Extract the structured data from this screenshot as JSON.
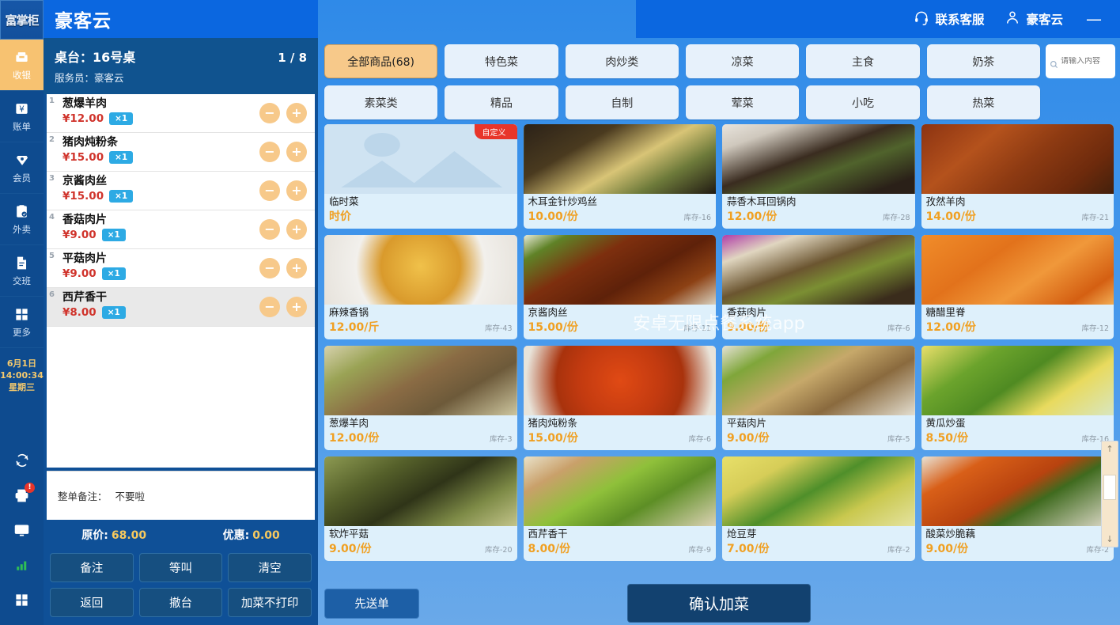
{
  "rail": {
    "logo": "富掌柜",
    "items": [
      {
        "label": "收银",
        "icon": "cash-register-icon",
        "active": true
      },
      {
        "label": "账单",
        "icon": "bill-icon",
        "active": false
      },
      {
        "label": "会员",
        "icon": "member-diamond-icon",
        "active": false
      },
      {
        "label": "外卖",
        "icon": "takeout-clipboard-icon",
        "active": false
      },
      {
        "label": "交班",
        "icon": "shift-handover-icon",
        "active": false
      },
      {
        "label": "更多",
        "icon": "more-grid-icon",
        "active": false
      }
    ],
    "datetime": {
      "date": "6月1日",
      "time": "14:00:34",
      "weekday": "星期三"
    },
    "bottom_icons": [
      {
        "name": "refresh-sync-icon",
        "badge": ""
      },
      {
        "name": "printer-icon",
        "badge": "!"
      },
      {
        "name": "monitor-icon",
        "badge": ""
      },
      {
        "name": "signal-bars-icon",
        "badge": ""
      },
      {
        "name": "apps-grid-icon",
        "badge": ""
      }
    ]
  },
  "header": {
    "app_title": "豪客云",
    "support_label": "联系客服",
    "user_label": "豪客云",
    "minimize_label": "—"
  },
  "order": {
    "table_label": "桌台：",
    "table_name": "16号桌",
    "page_indicator": "1 / 8",
    "staff_label": "服务员：",
    "staff_name": "豪客云",
    "items": [
      {
        "index": "1",
        "name": "葱爆羊肉",
        "price": "¥12.00",
        "qty": "×1"
      },
      {
        "index": "2",
        "name": "猪肉炖粉条",
        "price": "¥15.00",
        "qty": "×1"
      },
      {
        "index": "3",
        "name": "京酱肉丝",
        "price": "¥15.00",
        "qty": "×1"
      },
      {
        "index": "4",
        "name": "香菇肉片",
        "price": "¥9.00",
        "qty": "×1"
      },
      {
        "index": "5",
        "name": "平菇肉片",
        "price": "¥9.00",
        "qty": "×1"
      },
      {
        "index": "6",
        "name": "西芹香干",
        "price": "¥8.00",
        "qty": "×1"
      }
    ],
    "remark_label": "整单备注：",
    "remark_value": "不要啦",
    "original_price_label": "原价:",
    "original_price": "68.00",
    "discount_label": "优惠:",
    "discount": "0.00",
    "actions": [
      "备注",
      "等叫",
      "清空",
      "返回",
      "撤台",
      "加菜不打印"
    ],
    "minus_label": "−",
    "plus_label": "+"
  },
  "categories": [
    {
      "label": "全部商品(68)",
      "active": true
    },
    {
      "label": "特色菜",
      "active": false
    },
    {
      "label": "肉炒类",
      "active": false
    },
    {
      "label": "凉菜",
      "active": false
    },
    {
      "label": "主食",
      "active": false
    },
    {
      "label": "奶茶",
      "active": false
    },
    {
      "label": "素菜类",
      "active": false
    },
    {
      "label": "精品",
      "active": false
    },
    {
      "label": "自制",
      "active": false
    },
    {
      "label": "荤菜",
      "active": false
    },
    {
      "label": "小吃",
      "active": false
    },
    {
      "label": "热菜",
      "active": false
    }
  ],
  "search": {
    "placeholder": "请输入内容",
    "value": ""
  },
  "products": [
    {
      "name": "临时菜",
      "price": "时价",
      "stock": "",
      "ribbon": "自定义",
      "img": "placeholder"
    },
    {
      "name": "木耳金针炒鸡丝",
      "price": "10.00/份",
      "stock": "库存-16",
      "ribbon": "",
      "img": "noodle-stirfry"
    },
    {
      "name": "蒜香木耳回锅肉",
      "price": "12.00/份",
      "stock": "库存-28",
      "ribbon": "",
      "img": "fungus-pork"
    },
    {
      "name": "孜然羊肉",
      "price": "14.00/份",
      "stock": "库存-21",
      "ribbon": "",
      "img": "cumin-lamb"
    },
    {
      "name": "麻辣香锅",
      "price": "12.00/斤",
      "stock": "库存-43",
      "ribbon": "",
      "img": "spicy-pot"
    },
    {
      "name": "京酱肉丝",
      "price": "15.00/份",
      "stock": "库存-11",
      "ribbon": "",
      "img": "jingjiang-pork"
    },
    {
      "name": "香菇肉片",
      "price": "9.00/份",
      "stock": "库存-6",
      "ribbon": "",
      "img": "mushroom-pork"
    },
    {
      "name": "糖醋里脊",
      "price": "12.00/份",
      "stock": "库存-12",
      "ribbon": "",
      "img": "sweet-sour-pork"
    },
    {
      "name": "葱爆羊肉",
      "price": "12.00/份",
      "stock": "库存-3",
      "ribbon": "",
      "img": "scallion-lamb"
    },
    {
      "name": "猪肉炖粉条",
      "price": "15.00/份",
      "stock": "库存-6",
      "ribbon": "",
      "img": "pork-noodle-stew"
    },
    {
      "name": "平菇肉片",
      "price": "9.00/份",
      "stock": "库存-5",
      "ribbon": "",
      "img": "oyster-mushroom-pork"
    },
    {
      "name": "黄瓜炒蛋",
      "price": "8.50/份",
      "stock": "库存-16",
      "ribbon": "",
      "img": "cucumber-egg"
    },
    {
      "name": "软炸平菇",
      "price": "9.00/份",
      "stock": "库存-20",
      "ribbon": "",
      "img": "fried-mushroom"
    },
    {
      "name": "西芹香干",
      "price": "8.00/份",
      "stock": "库存-9",
      "ribbon": "",
      "img": "celery-tofu"
    },
    {
      "name": "炝豆芽",
      "price": "7.00/份",
      "stock": "库存-2",
      "ribbon": "",
      "img": "bean-sprouts"
    },
    {
      "name": "酸菜炒脆藕",
      "price": "9.00/份",
      "stock": "库存-2",
      "ribbon": "",
      "img": "pickle-lotus"
    }
  ],
  "watermark": "安卓无限点餐系统app",
  "footer": {
    "send_first": "先送单",
    "confirm": "确认加菜"
  },
  "scrollbar": {
    "up": "↑",
    "down": "↓"
  },
  "colors": {
    "brand_blue": "#0b67e0",
    "panel_blue": "#0f5097",
    "rail_blue": "#0e4b8f",
    "accent_orange": "#f7c98a",
    "price_orange": "#f0a022",
    "price_red": "#d0342c",
    "qty_blue": "#2daae4",
    "badge_red": "#e8352a",
    "total_gold": "#f6c95e"
  }
}
